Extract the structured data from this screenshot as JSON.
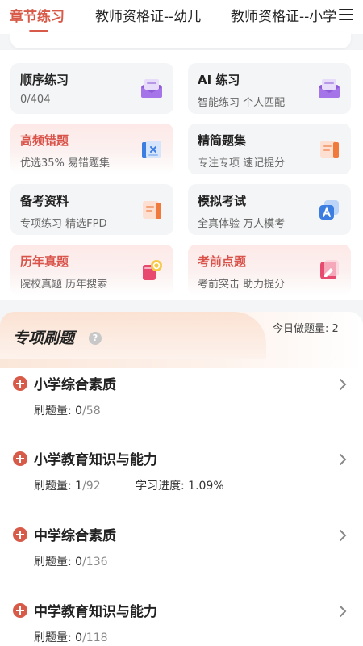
{
  "tabs": [
    {
      "label": "章节练习",
      "active": true
    },
    {
      "label": "教师资格证--幼儿",
      "active": false
    },
    {
      "label": "教师资格证--小学",
      "active": false
    }
  ],
  "tiles": [
    {
      "title": "顺序练习",
      "subtitle": "0/404",
      "icon": "envelope-icon",
      "style": "gray"
    },
    {
      "title": "AI 练习",
      "subtitle": "智能练习 个人匹配",
      "icon": "envelope-icon",
      "style": "gray"
    },
    {
      "title": "高频错题",
      "subtitle": "优选35% 易错题集",
      "icon": "wrong-question-icon",
      "style": "pink"
    },
    {
      "title": "精简题集",
      "subtitle": "专注专项 速记提分",
      "icon": "notes-icon",
      "style": "gray"
    },
    {
      "title": "备考资料",
      "subtitle": "专项练习 精选FPD",
      "icon": "document-icon",
      "style": "gray"
    },
    {
      "title": "模拟考试",
      "subtitle": "全真体验 万人模考",
      "icon": "exam-icon",
      "style": "gray"
    },
    {
      "title": "历年真题",
      "subtitle": "院校真题 历年搜索",
      "icon": "search-paper-icon",
      "style": "pink"
    },
    {
      "title": "考前点题",
      "subtitle": "考前突击 助力提分",
      "icon": "edit-paper-icon",
      "style": "pink"
    }
  ],
  "section": {
    "title": "专项刷题",
    "help_icon": "?",
    "today_label": "今日做题量:",
    "today_value": "2"
  },
  "subjects": [
    {
      "name": "小学综合素质",
      "count_label": "刷题量:",
      "done": "0",
      "total": "/58",
      "progress_label": "",
      "progress_value": ""
    },
    {
      "name": "小学教育知识与能力",
      "count_label": "刷题量:",
      "done": "1",
      "total": "/92",
      "progress_label": "学习进度:",
      "progress_value": "1.09%"
    },
    {
      "name": "中学综合素质",
      "count_label": "刷题量:",
      "done": "0",
      "total": "/136",
      "progress_label": "",
      "progress_value": ""
    },
    {
      "name": "中学教育知识与能力",
      "count_label": "刷题量:",
      "done": "0",
      "total": "/118",
      "progress_label": "",
      "progress_value": ""
    }
  ],
  "colors": {
    "accent": "#d85a48",
    "purple": "#8e5bd6",
    "blue": "#3b7de0",
    "orange": "#f07a3c",
    "pink": "#e84a6f"
  }
}
